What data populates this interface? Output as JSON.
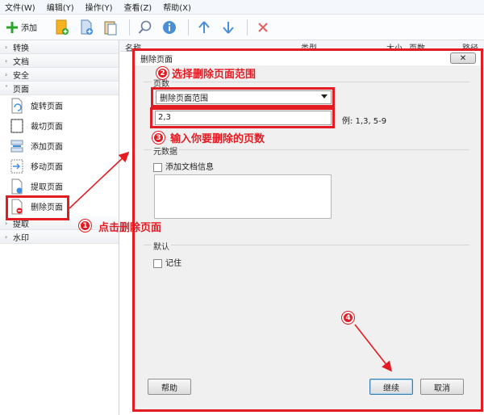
{
  "menubar": {
    "items": [
      "文件(W)",
      "编辑(Y)",
      "操作(Y)",
      "查看(Z)",
      "帮助(X)"
    ]
  },
  "toolbar": {
    "add_label": "添加"
  },
  "sidebar": {
    "categories_top": [
      "转换",
      "文档",
      "安全"
    ],
    "pages_category": "页面",
    "page_items": [
      "旋转页面",
      "裁切页面",
      "添加页面",
      "移动页面",
      "提取页面",
      "删除页面"
    ],
    "categories_bottom": [
      "提取",
      "水印"
    ]
  },
  "file_list": {
    "col_name": "名称",
    "col_type": "类型",
    "col_size": "大小",
    "col_pages": "页数",
    "col_path": "路径"
  },
  "dialog": {
    "title": "删除页面",
    "pages_group": "页数",
    "range_select": "删除页面范围",
    "pages_input": "2,3",
    "example": "例: 1,3, 5-9",
    "meta_group": "元数据",
    "add_doc_info": "添加文档信息",
    "default_group": "默认",
    "remember": "记住",
    "help_button": "帮助",
    "continue_button": "继续",
    "cancel_button": "取消"
  },
  "annotations": {
    "step1_number": "1",
    "step1_text": "点击删除页面",
    "step2_number": "2",
    "step2_text": "选择删除页面范围",
    "step3_number": "3",
    "step3_text": "输入你要删除的页数",
    "step4_number": "4"
  },
  "colors": {
    "annotation_red": "#e31b23",
    "add_green": "#2aa52a",
    "nav_blue": "#4a8fd6",
    "delete_red": "#e06060"
  }
}
